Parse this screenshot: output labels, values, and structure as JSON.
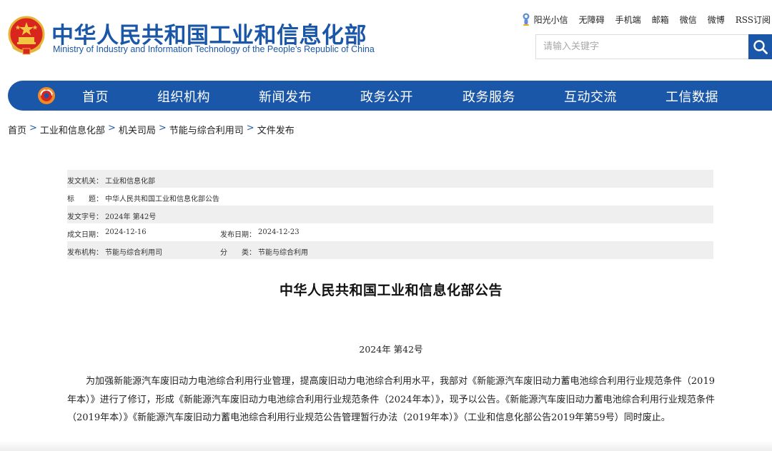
{
  "header": {
    "title_cn": "中华人民共和国工业和信息化部",
    "title_en": "Ministry of Industry and Information Technology of the People’s Republic of China",
    "top_links": [
      "阳光小信",
      "无障碍",
      "手机端",
      "邮箱",
      "微信",
      "微博",
      "RSS订阅"
    ],
    "search_placeholder": "请输入关键字"
  },
  "nav": {
    "items": [
      "首页",
      "组织机构",
      "新闻发布",
      "政务公开",
      "政务服务",
      "互动交流",
      "工信数据"
    ]
  },
  "breadcrumb": {
    "items": [
      "首页",
      "工业和信息化部",
      "机关司局",
      "节能与综合利用司",
      "文件发布"
    ],
    "separator": ">"
  },
  "meta": {
    "issuer_label": "发文机关：",
    "issuer_value": "工业和信息化部",
    "title_label": "标　　题：",
    "title_value": "中华人民共和国工业和信息化部公告",
    "docno_label": "发文字号：",
    "docno_value": "2024年 第42号",
    "created_label": "成文日期：",
    "created_value": "2024-12-16",
    "published_label": "发布日期：",
    "published_value": "2024-12-23",
    "org_label": "发布机构：",
    "org_value": "节能与综合利用司",
    "category_label": "分　　类：",
    "category_value": "节能与综合利用"
  },
  "article": {
    "title": "中华人民共和国工业和信息化部公告",
    "doc_number": "2024年 第42号",
    "paragraph": "为加强新能源汽车废旧动力电池综合利用行业管理，提高废旧动力电池综合利用水平，我部对《新能源汽车废旧动力蓄电池综合利用行业规范条件（2019年本）》进行了修订，形成《新能源汽车废旧动力电池综合利用行业规范条件（2024年本）》，现予以公告。《新能源汽车废旧动力蓄电池综合利用行业规范条件（2019年本）》《新能源汽车废旧动力蓄电池综合利用行业规范公告管理暂行办法（2019年本）》（工业和信息化部公告2019年第59号）同时废止。"
  },
  "colors": {
    "brand_blue": "#1b57a8",
    "meta_shade": "#efefef"
  }
}
